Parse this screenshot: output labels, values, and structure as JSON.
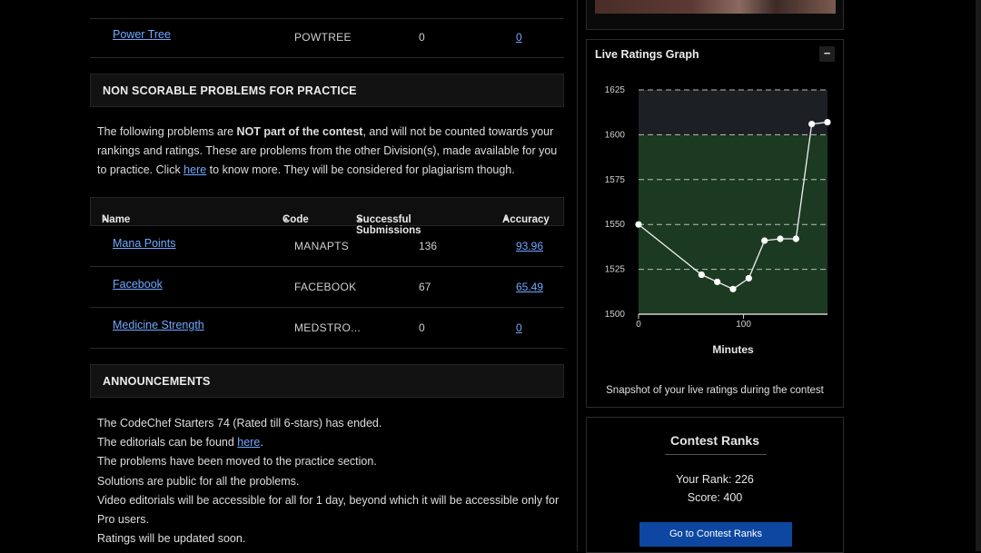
{
  "problems_top": [
    {
      "name": "Power Tree",
      "code": "POWTREE",
      "successful": "0",
      "accuracy": "0"
    }
  ],
  "nsp": {
    "heading": "NON SCORABLE PROBLEMS FOR PRACTICE",
    "text_1": "The following problems are ",
    "text_bold": "NOT part of the contest",
    "text_2": ", and will not be counted towards your rankings and ratings. These are problems from the other Division(s), made available for you to practice. Click ",
    "text_link": "here",
    "text_3": " to know more. They will be considered for plagiarism though.",
    "columns": [
      "Name",
      "Code",
      "Successful Submissions",
      "Accuracy"
    ],
    "rows": [
      {
        "name": "Mana Points",
        "code": "MANAPTS",
        "successful": "136",
        "accuracy": "93.96"
      },
      {
        "name": "Facebook",
        "code": "FACEBOOK",
        "successful": "67",
        "accuracy": "65.49"
      },
      {
        "name": "Medicine Strength",
        "code": "MEDSTRO...",
        "successful": "0",
        "accuracy": "0"
      }
    ]
  },
  "announcements": {
    "heading": "ANNOUNCEMENTS",
    "line_1": "The CodeChef Starters 74 (Rated till 6-stars) has ended.",
    "line_2_pre": "The editorials can be found ",
    "line_2_link": "here",
    "line_2_post": ".",
    "line_3": "The problems have been moved to the practice section.",
    "line_4": "Solutions are public for all the problems.",
    "line_5": "Video editorials will be accessible for all for 1 day, beyond which it will be accessible only for",
    "line_6": "Pro users.",
    "line_7": "Ratings will be updated soon."
  },
  "graph": {
    "title": "Live Ratings Graph",
    "collapse_label": "−",
    "caption": "Snapshot of your live ratings during the contest"
  },
  "chart_data": {
    "type": "line",
    "xlabel": "Minutes",
    "ylabel": "",
    "x_ticks": [
      0,
      100
    ],
    "y_ticks": [
      1500,
      1525,
      1550,
      1575,
      1600,
      1625
    ],
    "ylim": [
      1500,
      1625
    ],
    "xlim": [
      0,
      180
    ],
    "bands": [
      {
        "from": 1500,
        "to": 1600,
        "color": "#1c3a22"
      },
      {
        "from": 1600,
        "to": 1625,
        "color": "#1c1f24"
      }
    ],
    "series": [
      {
        "x": [
          0,
          60,
          75,
          90,
          105,
          120,
          135,
          150,
          165,
          180
        ],
        "y": [
          1550,
          1522,
          1518,
          1514,
          1520,
          1541,
          1542,
          1542,
          1606,
          1607
        ]
      }
    ],
    "grid": true
  },
  "ranks": {
    "title": "Contest Ranks",
    "your_rank": "Your Rank: 226",
    "score": "Score: 400",
    "button": "Go to Contest Ranks"
  },
  "colors": {
    "link": "#6fa8ff",
    "button": "#0d47a1",
    "band_green": "#1c3a22",
    "band_dark": "#1c1f24"
  }
}
